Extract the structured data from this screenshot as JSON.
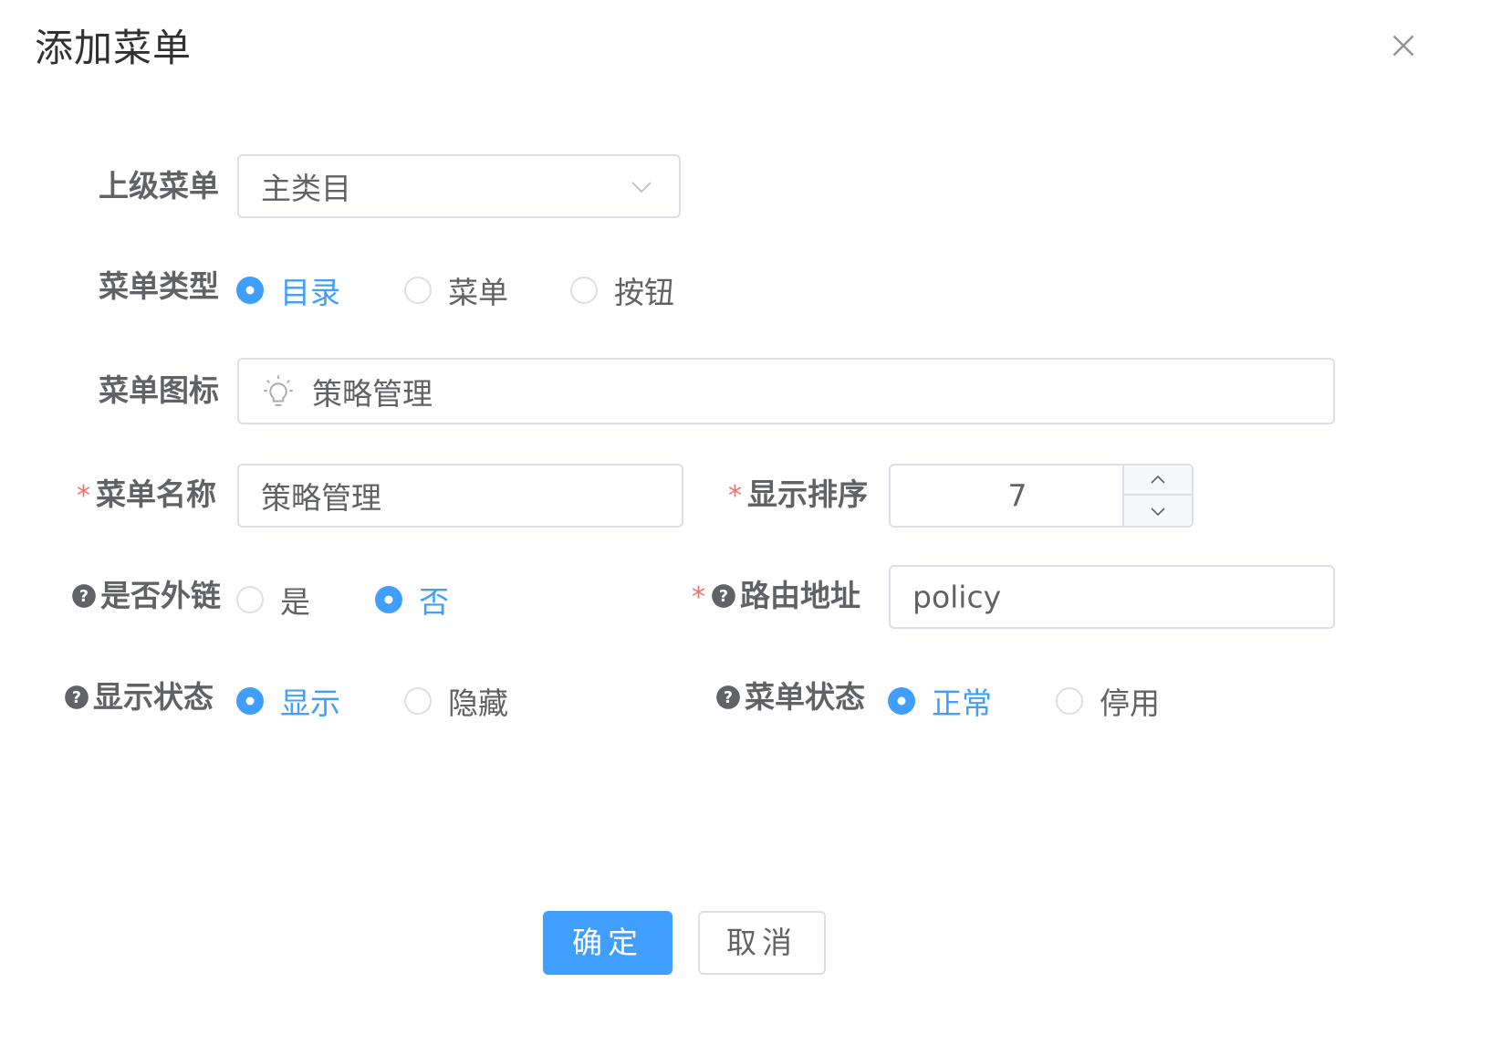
{
  "dialog": {
    "title": "添加菜单",
    "close_icon": "close-icon"
  },
  "form": {
    "parent_menu": {
      "label": "上级菜单",
      "value": "主类目"
    },
    "menu_type": {
      "label": "菜单类型",
      "options": [
        "目录",
        "菜单",
        "按钮"
      ],
      "selected": "目录"
    },
    "menu_icon": {
      "label": "菜单图标",
      "icon": "bulb-icon",
      "value": "策略管理"
    },
    "menu_name": {
      "required_mark": "*",
      "label": "菜单名称",
      "value": "策略管理"
    },
    "display_order": {
      "required_mark": "*",
      "label": "显示排序",
      "value": "7"
    },
    "is_external": {
      "label": "是否外链",
      "options": [
        "是",
        "否"
      ],
      "selected": "否"
    },
    "route_path": {
      "required_mark": "*",
      "label": "路由地址",
      "value": "policy"
    },
    "visible": {
      "label": "显示状态",
      "options": [
        "显示",
        "隐藏"
      ],
      "selected": "显示"
    },
    "menu_status": {
      "label": "菜单状态",
      "options": [
        "正常",
        "停用"
      ],
      "selected": "正常"
    }
  },
  "footer": {
    "confirm_label": "确定",
    "cancel_label": "取消"
  },
  "colors": {
    "primary": "#409eff",
    "required": "#f56c6c",
    "border": "#dcdfe6",
    "text": "#606266",
    "title": "#303133"
  }
}
